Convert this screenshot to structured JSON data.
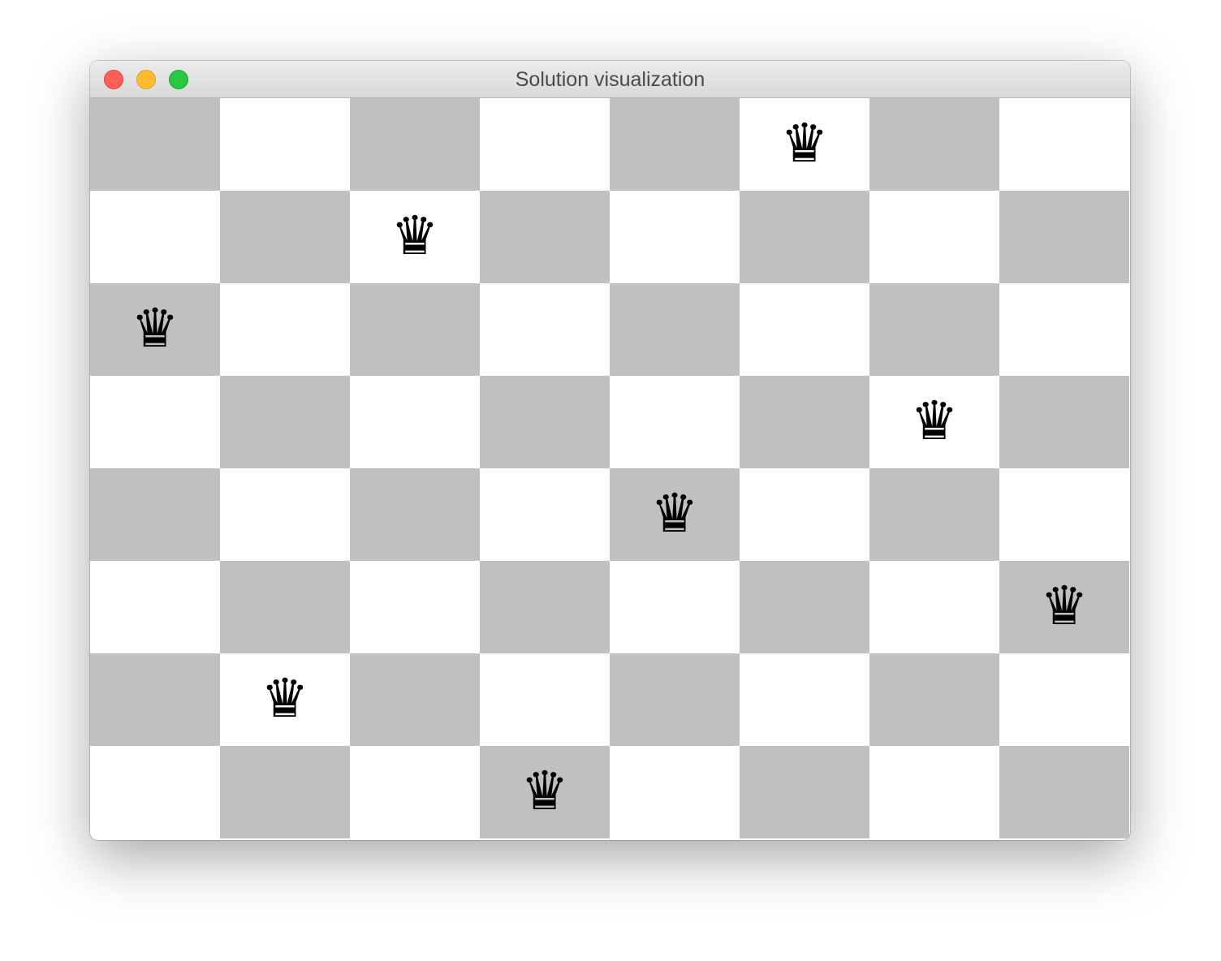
{
  "window": {
    "title": "Solution visualization"
  },
  "board": {
    "size": 8,
    "light_color": "#ffffff",
    "dark_color": "#c0c0c0",
    "queen_glyph": "♛",
    "queen_columns_by_row": [
      5,
      2,
      0,
      6,
      4,
      7,
      1,
      3
    ]
  }
}
